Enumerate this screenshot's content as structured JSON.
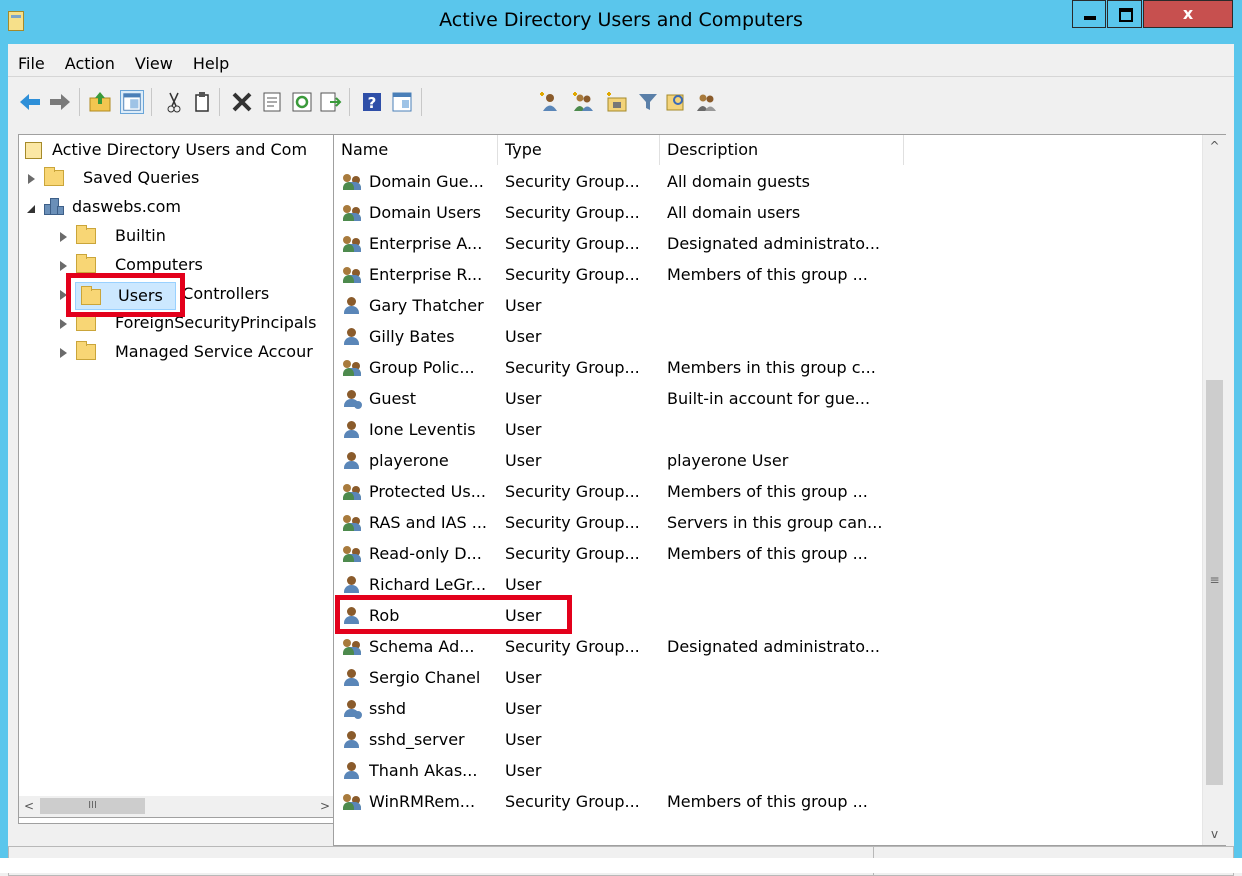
{
  "window": {
    "title": "Active Directory Users and Computers",
    "accent_color": "#5ac6ec",
    "close_color": "#c7504f",
    "close_label": "x"
  },
  "menu": [
    "File",
    "Action",
    "View",
    "Help"
  ],
  "toolbar": {
    "icons": [
      "back-arrow-icon",
      "forward-arrow-icon",
      "up-folder-icon",
      "show-tree-icon",
      "cut-icon",
      "copy-icon",
      "delete-icon",
      "properties-icon",
      "refresh-icon",
      "export-list-icon",
      "help-icon",
      "console-tree-icon",
      "new-user-icon",
      "new-group-icon",
      "new-ou-icon",
      "filter-icon",
      "find-icon",
      "add-to-group-icon"
    ]
  },
  "tree": {
    "root": "Active Directory Users and Com",
    "items": [
      {
        "label": "Saved Queries"
      },
      {
        "label": "daswebs.com"
      },
      {
        "label": "Builtin"
      },
      {
        "label": "Computers"
      },
      {
        "label": "Domain Controllers"
      },
      {
        "label": "ForeignSecurityPrincipals"
      },
      {
        "label": "Managed Service Accour"
      },
      {
        "label": "Users"
      }
    ],
    "selected": "Users",
    "scroll_thumb_grip": "III"
  },
  "list": {
    "columns": [
      "Name",
      "Type",
      "Description"
    ],
    "rows": [
      {
        "name": "Domain Gue...",
        "type": "Security Group...",
        "description": "All domain guests",
        "kind": "group"
      },
      {
        "name": "Domain Users",
        "type": "Security Group...",
        "description": "All domain users",
        "kind": "group"
      },
      {
        "name": "Enterprise A...",
        "type": "Security Group...",
        "description": "Designated administrato...",
        "kind": "group"
      },
      {
        "name": "Enterprise R...",
        "type": "Security Group...",
        "description": "Members of this group ...",
        "kind": "group"
      },
      {
        "name": "Gary Thatcher",
        "type": "User",
        "description": "",
        "kind": "user"
      },
      {
        "name": "Gilly Bates",
        "type": "User",
        "description": "",
        "kind": "user"
      },
      {
        "name": "Group Polic...",
        "type": "Security Group...",
        "description": "Members in this group c...",
        "kind": "group"
      },
      {
        "name": "Guest",
        "type": "User",
        "description": "Built-in account for gue...",
        "kind": "user-disabled"
      },
      {
        "name": "Ione Leventis",
        "type": "User",
        "description": "",
        "kind": "user"
      },
      {
        "name": "playerone",
        "type": "User",
        "description": "playerone User",
        "kind": "user"
      },
      {
        "name": "Protected Us...",
        "type": "Security Group...",
        "description": "Members of this group ...",
        "kind": "group"
      },
      {
        "name": "RAS and IAS ...",
        "type": "Security Group...",
        "description": "Servers in this group can...",
        "kind": "group"
      },
      {
        "name": "Read-only D...",
        "type": "Security Group...",
        "description": "Members of this group ...",
        "kind": "group"
      },
      {
        "name": "Richard LeGr...",
        "type": "User",
        "description": "",
        "kind": "user"
      },
      {
        "name": "Rob",
        "type": "User",
        "description": "",
        "kind": "user"
      },
      {
        "name": "Schema Ad...",
        "type": "Security Group...",
        "description": "Designated administrato...",
        "kind": "group"
      },
      {
        "name": "Sergio Chanel",
        "type": "User",
        "description": "",
        "kind": "user"
      },
      {
        "name": "sshd",
        "type": "User",
        "description": "",
        "kind": "user-disabled"
      },
      {
        "name": "sshd_server",
        "type": "User",
        "description": "",
        "kind": "user"
      },
      {
        "name": "Thanh Akas...",
        "type": "User",
        "description": "",
        "kind": "user"
      },
      {
        "name": "WinRMRem...",
        "type": "Security Group...",
        "description": "Members of this group ...",
        "kind": "group"
      }
    ],
    "highlighted": "Rob",
    "highlight_color": "#e3001b"
  },
  "scrollbar": {
    "grip": "≡",
    "up": "^",
    "down": "v",
    "left": "<",
    "right": ">"
  }
}
